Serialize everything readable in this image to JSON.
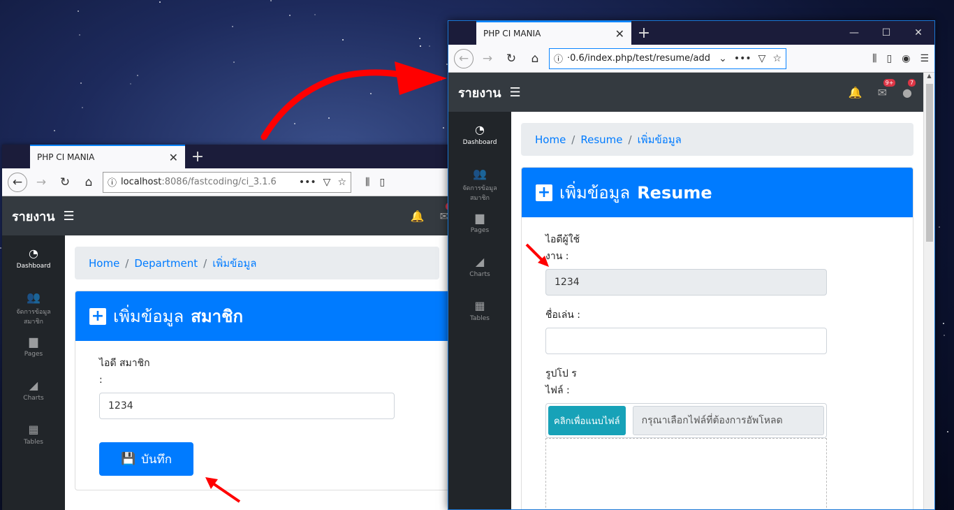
{
  "back_window": {
    "tab_title": "PHP CI MANIA",
    "url_host": "localhost",
    "url_rest": ":8086/fastcoding/ci_3.1.6",
    "brand": "รายงาน",
    "badge_bell": "9+",
    "sidebar": [
      "Dashboard",
      "จัดการข้อมูล สมาชิก",
      "Pages",
      "Charts",
      "Tables"
    ],
    "breadcrumb": [
      "Home",
      "Department",
      "เพิ่มข้อมูล"
    ],
    "card_title_prefix": "เพิ่มข้อมูล",
    "card_title_bold": "สมาชิก",
    "field_label": "ไอดี สมาชิก :",
    "field_value": "1234",
    "save_label": "บันทึก"
  },
  "front_window": {
    "tab_title": "PHP CI MANIA",
    "url": "·0.6/index.php/test/resume/add",
    "brand": "รายงาน",
    "badge_mail": "9+",
    "badge_user": "7",
    "sidebar": [
      "Dashboard",
      "จัดการข้อมูล สมาชิก",
      "Pages",
      "Charts",
      "Tables"
    ],
    "breadcrumb": [
      "Home",
      "Resume",
      "เพิ่มข้อมูล"
    ],
    "card_title_prefix": "เพิ่มข้อมูล",
    "card_title_bold": "Resume",
    "userid_label": "ไอดีผู้ใช้ งาน :",
    "userid_value": "1234",
    "nickname_label": "ชื่อเล่น :",
    "nickname_value": "",
    "photo_label": "รูปโป รไฟล์ :",
    "file_button": "คลิกเพื่อแนบไฟล์",
    "file_placeholder": "กรุณาเลือกไฟล์ที่ต้องการอัพโหลด"
  },
  "colors": {
    "primary": "#007bff",
    "dark": "#343a40",
    "sidebar": "#212529",
    "info": "#17a2b8",
    "annotation_red": "#ff0000"
  }
}
